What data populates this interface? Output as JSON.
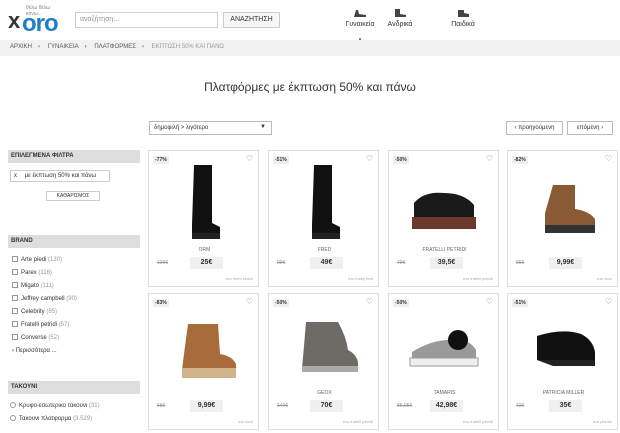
{
  "header": {
    "logo_text": "oro",
    "logo_x": "x",
    "tagline": "θέλω θέλω κάνω...",
    "search_placeholder": "αναζήτηση...",
    "search_button": "ΑΝΑΖΗΤΗΣΗ",
    "categories": [
      {
        "label": "Γυναικεία",
        "icon": "heel-shoe-icon"
      },
      {
        "label": "Ανδρικά",
        "icon": "boot-icon"
      },
      {
        "label": "Παιδικά",
        "icon": "kids-shoe-icon"
      }
    ]
  },
  "breadcrumb": [
    "ΑΡΧΙΚΗ",
    "ΓΥΝΑΙΚΕΙΑ",
    "ΠΛΑΤΦΟΡΜΕΣ",
    "ΕΚΠΤΩΣΗ 50% ΚΑΙ ΠΑΝΩ"
  ],
  "page_title": "Πλατφόρμες με έκπτωση 50% και πάνω",
  "sort": {
    "value": "δημοφιλή > λιγότερο"
  },
  "pagination": {
    "prev": "‹ προηγούμενη",
    "next": "επόμενη ›"
  },
  "sidebar": {
    "filters_heading": "ΕΠΙΛΕΓΜΕΝΑ ΦΙΛΤΡΑ",
    "active_filter": "με έκπτωση 50% και πάνω",
    "clear_label": "ΚΑΘΑΡΙΣΜΟΣ",
    "brand_heading": "BRAND",
    "brands": [
      {
        "name": "Arte piedi",
        "count": "(130)"
      },
      {
        "name": "Parex",
        "count": "(116)"
      },
      {
        "name": "Migato",
        "count": "(111)"
      },
      {
        "name": "Jeffrey campbell",
        "count": "(90)"
      },
      {
        "name": "Celebrity",
        "count": "(85)"
      },
      {
        "name": "Fratelli petridi",
        "count": "(57)"
      },
      {
        "name": "Converse",
        "count": "(52)"
      }
    ],
    "more_label": "Περισσότερα ...",
    "heel_heading": "ΤΑΚΟΥΝΙ",
    "heels": [
      {
        "name": "Κρυφο-εσωτερικο τακουνι",
        "count": "(31)"
      },
      {
        "name": "Τακουνι πλατφορμα",
        "count": "(3.529)"
      }
    ]
  },
  "products": [
    {
      "discount": "-77%",
      "brand": "ORM",
      "old_price": "109€",
      "price": "25€",
      "store": "στο mem kiokio",
      "shape": "boot-tall"
    },
    {
      "discount": "-51%",
      "brand": "FRED",
      "old_price": "99€",
      "price": "49€",
      "store": "στο funky fred",
      "shape": "boot-tall"
    },
    {
      "discount": "-50%",
      "brand": "FRATELLI PETRIDI",
      "old_price": "79€",
      "price": "39,5€",
      "store": "στο fratelli petridi",
      "shape": "oxford"
    },
    {
      "discount": "-82%",
      "brand": "",
      "old_price": "55€",
      "price": "9,99€",
      "store": "στο toco",
      "shape": "ankle-boot"
    },
    {
      "discount": "-83%",
      "brand": "",
      "old_price": "58€",
      "price": "9,99€",
      "store": "στο toco",
      "shape": "lace-boot"
    },
    {
      "discount": "-50%",
      "brand": "GEOX",
      "old_price": "140€",
      "price": "70€",
      "store": "στο fratelli petridi",
      "shape": "wedge-sneaker"
    },
    {
      "discount": "-50%",
      "brand": "TAMARIS",
      "old_price": "85,95€",
      "price": "42,98€",
      "store": "στο fratelli petridi",
      "shape": "silver-shoe"
    },
    {
      "discount": "-51%",
      "brand": "PATRICIA MILLER",
      "old_price": "72€",
      "price": "35€",
      "store": "στο planito",
      "shape": "black-wedge"
    }
  ],
  "colors": {
    "brand_blue": "#1e7fc5",
    "sidebar_heading": "#dddddd"
  }
}
